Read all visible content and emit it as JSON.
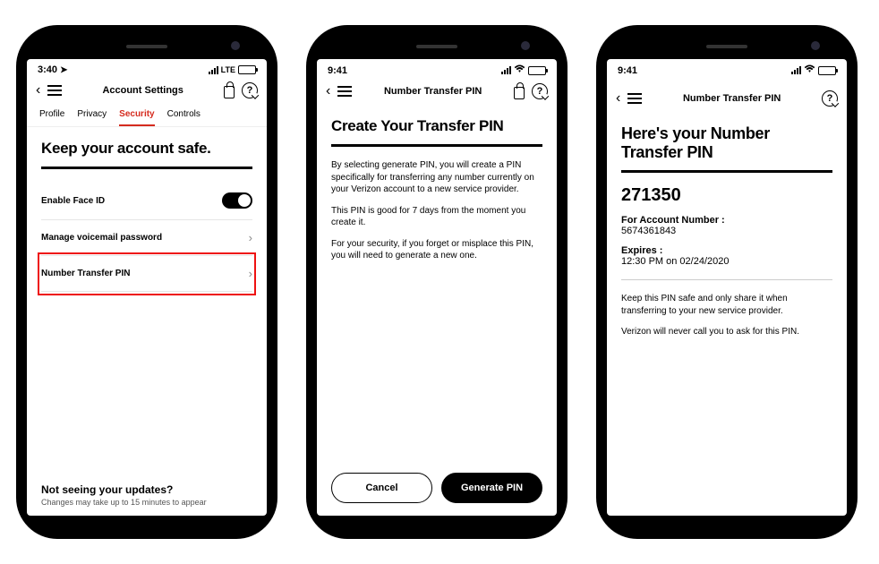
{
  "phone1": {
    "status": {
      "time": "3:40",
      "net_label": "LTE"
    },
    "nav": {
      "title": "Account Settings"
    },
    "tabs": {
      "profile": "Profile",
      "privacy": "Privacy",
      "security": "Security",
      "controls": "Controls"
    },
    "heading": "Keep your account safe.",
    "rows": {
      "face_id": "Enable Face ID",
      "voicemail": "Manage voicemail password",
      "transfer_pin": "Number Transfer PIN"
    },
    "footer": {
      "title": "Not seeing your updates?",
      "sub": "Changes may take up to 15 minutes to appear"
    }
  },
  "phone2": {
    "status": {
      "time": "9:41"
    },
    "nav": {
      "title": "Number Transfer PIN"
    },
    "heading": "Create Your Transfer PIN",
    "p1": "By selecting generate PIN, you will create a PIN specifically for transferring any number currently on your Verizon account to a new service provider.",
    "p2": "This PIN is good for 7 days from the moment you create it.",
    "p3": "For your security, if you forget or misplace this PIN, you will need to generate a new one.",
    "buttons": {
      "cancel": "Cancel",
      "generate": "Generate PIN"
    }
  },
  "phone3": {
    "status": {
      "time": "9:41"
    },
    "nav": {
      "title": "Number Transfer PIN"
    },
    "heading": "Here's your Number Transfer PIN",
    "pin": "271350",
    "acct_label": "For Account Number :",
    "acct_value": "5674361843",
    "exp_label": "Expires :",
    "exp_value": "12:30 PM on 02/24/2020",
    "note1": "Keep this PIN safe and only share it when transferring to your new service provider.",
    "note2": "Verizon will never call you to ask for this PIN."
  }
}
